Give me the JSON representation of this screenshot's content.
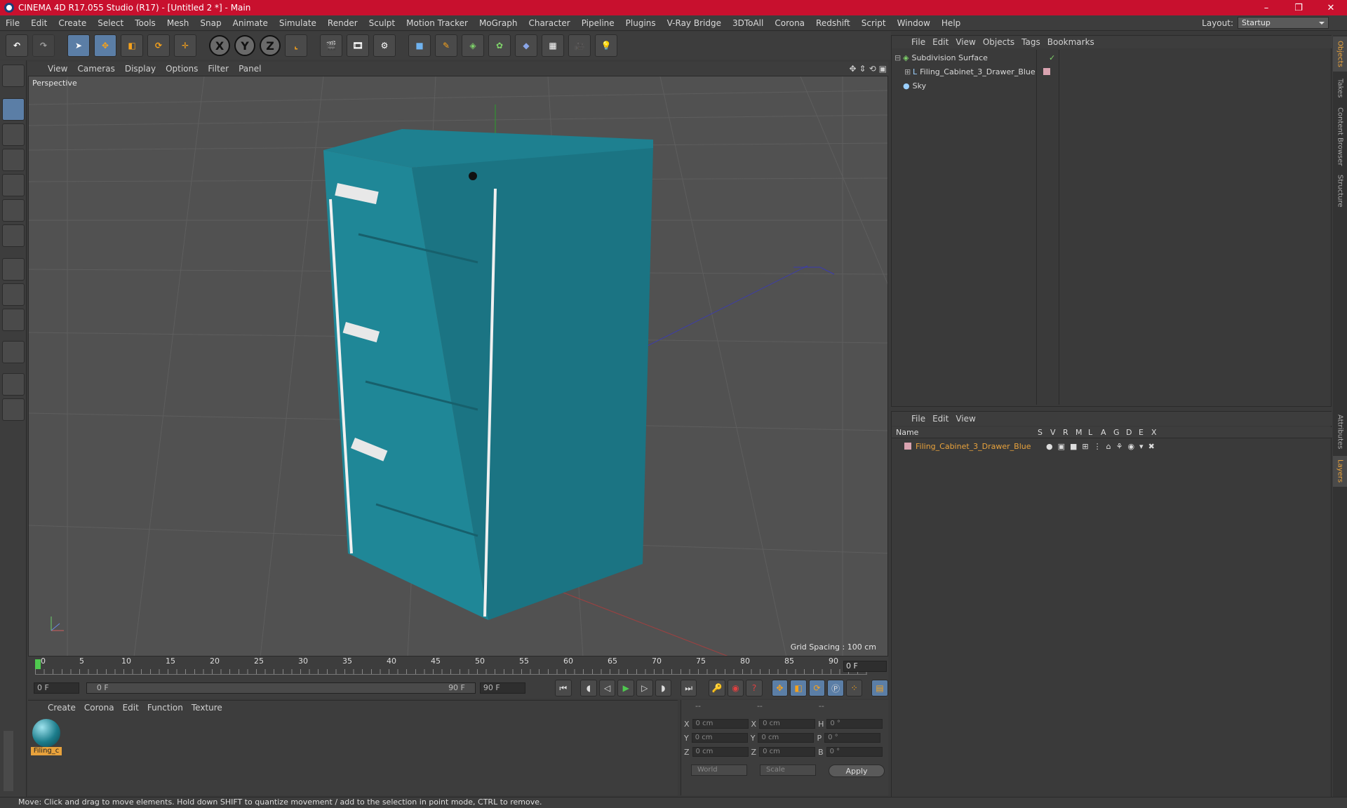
{
  "window": {
    "title": "CINEMA 4D R17.055 Studio (R17) - [Untitled 2 *] - Main",
    "controls": [
      "–",
      "❐",
      "✕"
    ]
  },
  "menubar": {
    "items": [
      "File",
      "Edit",
      "Create",
      "Select",
      "Tools",
      "Mesh",
      "Snap",
      "Animate",
      "Simulate",
      "Render",
      "Sculpt",
      "Motion Tracker",
      "MoGraph",
      "Character",
      "Pipeline",
      "Plugins",
      "V-Ray Bridge",
      "3DToAll",
      "Corona",
      "Redshift",
      "Script",
      "Window",
      "Help"
    ],
    "layout_label": "Layout:",
    "layout_value": "Startup"
  },
  "viewport": {
    "menu": [
      "View",
      "Cameras",
      "Display",
      "Options",
      "Filter",
      "Panel"
    ],
    "label": "Perspective",
    "grid_spacing": "Grid Spacing : 100 cm",
    "colors": {
      "bg": "#515151",
      "cabinet": "#1c7d8c",
      "grid": "#5c5c5c"
    }
  },
  "timeline": {
    "ticks": [
      "0",
      "5",
      "10",
      "15",
      "20",
      "25",
      "30",
      "35",
      "40",
      "45",
      "50",
      "55",
      "60",
      "65",
      "70",
      "75",
      "80",
      "85",
      "90"
    ],
    "current_frame": "0 F",
    "start_field": "0 F",
    "range_start": "0 F",
    "range_end": "90 F",
    "end_field": "90 F"
  },
  "materials": {
    "menu": [
      "Create",
      "Corona",
      "Edit",
      "Function",
      "Texture"
    ],
    "items": [
      {
        "name": "Filing_c"
      }
    ]
  },
  "coordinates": {
    "header": [
      "--",
      "--",
      "--"
    ],
    "rows": [
      {
        "a": "X",
        "av": "0 cm",
        "b": "X",
        "bv": "0 cm",
        "c": "H",
        "cv": "0 °"
      },
      {
        "a": "Y",
        "av": "0 cm",
        "b": "Y",
        "bv": "0 cm",
        "c": "P",
        "cv": "0 °"
      },
      {
        "a": "Z",
        "av": "0 cm",
        "b": "Z",
        "bv": "0 cm",
        "c": "B",
        "cv": "0 °"
      }
    ],
    "mode1": "World",
    "mode2": "Scale",
    "apply": "Apply"
  },
  "objects": {
    "menu": [
      "File",
      "Edit",
      "View",
      "Objects",
      "Tags",
      "Bookmarks"
    ],
    "items": [
      {
        "name": "Subdivision Surface",
        "indent": 0
      },
      {
        "name": "Filing_Cabinet_3_Drawer_Blue",
        "indent": 1
      },
      {
        "name": "Sky",
        "indent": 0
      }
    ]
  },
  "layers": {
    "menu": [
      "File",
      "Edit",
      "View"
    ],
    "columns": [
      "Name",
      "S",
      "V",
      "R",
      "M",
      "L",
      "A",
      "G",
      "D",
      "E",
      "X"
    ],
    "rows": [
      {
        "name": "Filing_Cabinet_3_Drawer_Blue",
        "color": "#e8a23c"
      }
    ]
  },
  "sidetabs": [
    "Objects",
    "Takes",
    "Content Browser",
    "Structure",
    "Attributes",
    "Layers"
  ],
  "status": "Move: Click and drag to move elements. Hold down SHIFT to quantize movement / add to the selection in point mode, CTRL to remove."
}
